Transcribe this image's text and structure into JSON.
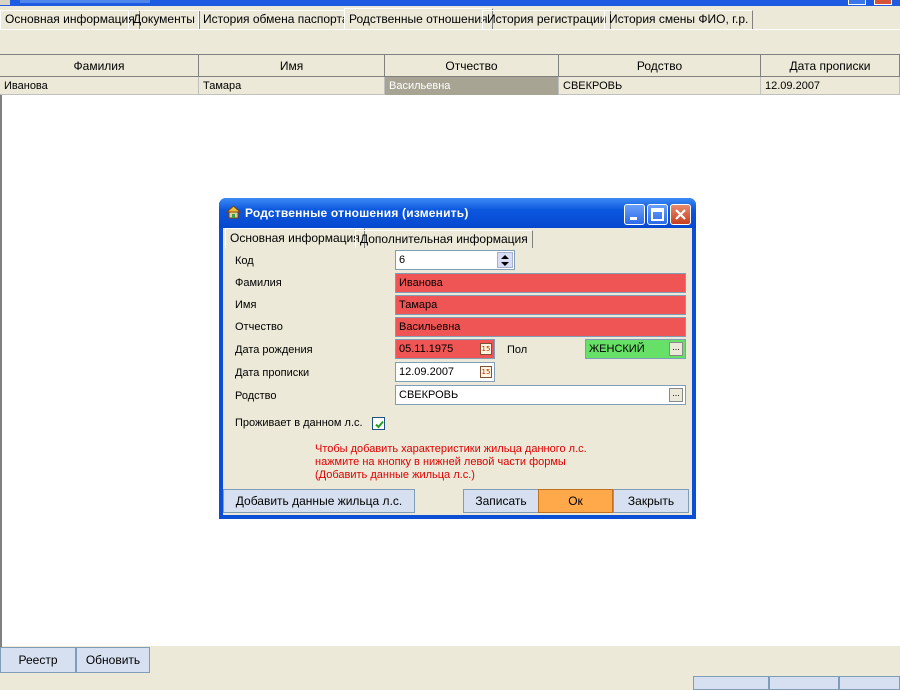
{
  "main_tabs": [
    {
      "label": "Основная информация"
    },
    {
      "label": "Документы"
    },
    {
      "label": "История обмена паспорта"
    },
    {
      "label": "Родственные отношения"
    },
    {
      "label": "История регистрации"
    },
    {
      "label": "История смены ФИО, г.р."
    }
  ],
  "grid": {
    "columns": [
      "Фамилия",
      "Имя",
      "Отчество",
      "Родство",
      "Дата прописки"
    ],
    "rows": [
      {
        "cells": [
          "Иванова",
          "Тамара",
          "Васильевна",
          "СВЕКРОВЬ",
          "12.09.2007"
        ]
      }
    ]
  },
  "bottom": {
    "registry_button": "Реестр",
    "refresh_button": "Обновить"
  },
  "dialog": {
    "title": "Родственные отношения (изменить)",
    "tabs": [
      {
        "label": "Основная информация"
      },
      {
        "label": "Дополнительная информация"
      }
    ],
    "fields": {
      "code_label": "Код",
      "code_value": "6",
      "lastname_label": "Фамилия",
      "lastname_value": "Иванова",
      "firstname_label": "Имя",
      "firstname_value": "Тамара",
      "patronymic_label": "Отчество",
      "patronymic_value": "Васильевна",
      "birthdate_label": "Дата рождения",
      "birthdate_value": "05.11.1975",
      "gender_label": "Пол",
      "gender_value": "ЖЕНСКИЙ",
      "regdate_label": "Дата прописки",
      "regdate_value": "12.09.2007",
      "kinship_label": "Родство",
      "kinship_value": "СВЕКРОВЬ",
      "lives_label": "Проживает в данном л.с."
    },
    "note_lines": [
      "Чтобы добавить характеристики жильца данного л.с.",
      "нажмите на кнопку в нижней левой части формы",
      "(Добавить данные жильца л.с.)"
    ],
    "buttons": {
      "add_resident": "Добавить данные жильца л.с.",
      "save": "Записать",
      "ok": "Ок",
      "close": "Закрыть"
    }
  },
  "colors": {
    "required_field": "#f05555",
    "gender_field": "#66e066",
    "ok_button": "#ffa94a",
    "note_text": "#e00000",
    "titlebar": "#0b57de"
  }
}
